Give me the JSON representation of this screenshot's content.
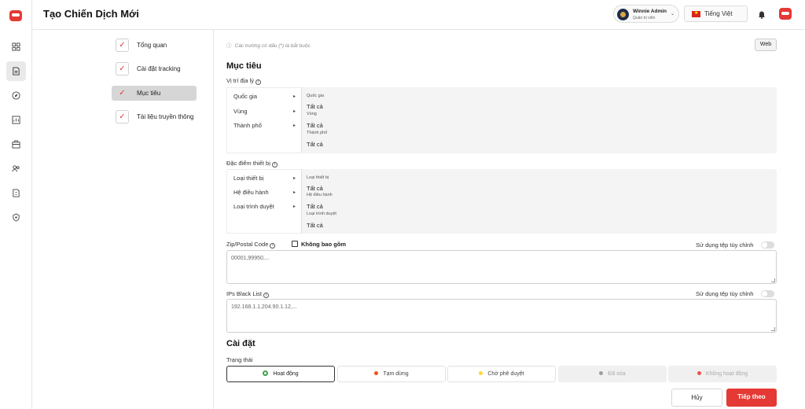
{
  "header": {
    "title": "Tạo Chiến Dịch Mới",
    "user_name": "Winnie Admin",
    "user_role": "Quản trị viên",
    "language": "Tiếng Việt"
  },
  "steps": [
    {
      "label": "Tổng quan",
      "active": false
    },
    {
      "label": "Cài đặt tracking",
      "active": false
    },
    {
      "label": "Mục tiêu",
      "active": true
    },
    {
      "label": "Tài liệu truyền thông",
      "active": false
    }
  ],
  "main": {
    "note": "Các trường có dấu (*) là bắt buộc",
    "web_button": "Web",
    "section_target": "Mục tiêu",
    "location": {
      "label": "Vị trí địa lý",
      "menu": [
        "Quốc gia",
        "Vùng",
        "Thành phố"
      ],
      "values": [
        {
          "heading": "Quốc gia",
          "value": "Tất cả"
        },
        {
          "heading": "Vùng",
          "value": "Tất cả"
        },
        {
          "heading": "Thành phố",
          "value": "Tất cả"
        }
      ]
    },
    "device": {
      "label": "Đặc điểm thiết bị",
      "menu": [
        "Loại thiết bị",
        "Hệ điều hành",
        "Loại trình duyệt"
      ],
      "values": [
        {
          "heading": "Loại thiết bị",
          "value": "Tất cả"
        },
        {
          "heading": "Hệ điều hành",
          "value": "Tất cả"
        },
        {
          "heading": "Loại trình duyệt",
          "value": "Tất cả"
        }
      ]
    },
    "zip": {
      "label": "Zip/Postal Code",
      "exclude_label": "Không bao gồm",
      "custom_file_label": "Sử dụng tệp tùy chỉnh",
      "placeholder": "00001,99950,..."
    },
    "ips": {
      "label": "IPs Black List",
      "custom_file_label": "Sử dụng tệp tùy chỉnh",
      "placeholder": "192.168.1.1,204.90.1.12,..."
    },
    "section_settings": "Cài đặt",
    "status_label": "Trạng thái",
    "statuses": [
      {
        "label": "Hoạt động",
        "color": "#43a047"
      },
      {
        "label": "Tạm dừng",
        "color": "#f4511e"
      },
      {
        "label": "Chờ phê duyệt",
        "color": "#fdd835"
      },
      {
        "label": "Đã xóa",
        "color": "#9e9e9e"
      },
      {
        "label": "Không hoạt động",
        "color": "#ef5350"
      }
    ],
    "cancel_button": "Hủy",
    "next_button": "Tiếp theo"
  },
  "colors": {
    "accent": "#e53935"
  }
}
